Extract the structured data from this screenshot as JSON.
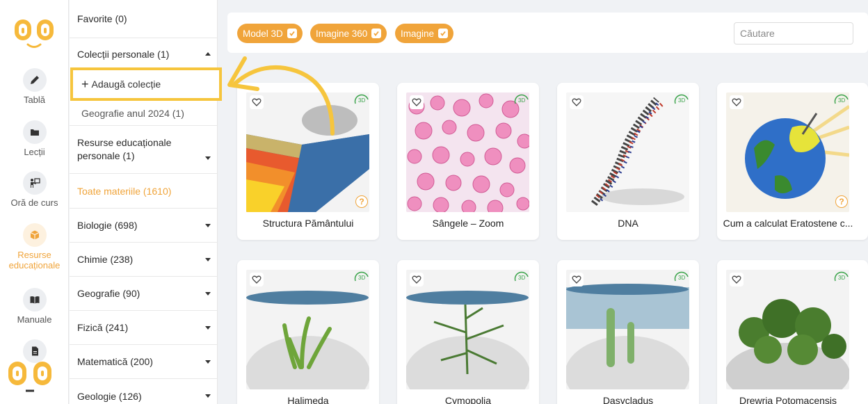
{
  "rail": {
    "items": [
      {
        "label": "Tablă",
        "icon": "pencil-icon"
      },
      {
        "label": "Lecții",
        "icon": "folder-icon"
      },
      {
        "label": "Oră de curs",
        "icon": "teacher-icon"
      },
      {
        "label": "Resurse educaționale",
        "icon": "cube-icon",
        "active": true
      },
      {
        "label": "Manuale",
        "icon": "book-icon"
      },
      {
        "label": "",
        "icon": "document-icon"
      }
    ]
  },
  "sidebar": {
    "favorites": "Favorite (0)",
    "personal_collections": "Colecții personale (1)",
    "add_collection": "Adaugă colecție",
    "collection_item": "Geografie anul 2024 (1)",
    "personal_resources": "Resurse educaționale personale (1)",
    "all_materials": "Toate materiile (1610)",
    "subjects": [
      "Biologie (698)",
      "Chimie (238)",
      "Geografie (90)",
      "Fizică (241)",
      "Matematică (200)",
      "Geologie (126)"
    ]
  },
  "filters": {
    "chips": [
      "Model 3D",
      "Imagine 360",
      "Imagine"
    ],
    "search_placeholder": "Căutare"
  },
  "cards": [
    {
      "title": "Structura Pământului",
      "help": "?"
    },
    {
      "title": "Sângele – Zoom"
    },
    {
      "title": "DNA"
    },
    {
      "title": "Cum a calculat Eratostene c...",
      "help": "?"
    },
    {
      "title": "Halimeda"
    },
    {
      "title": "Cymopolia"
    },
    {
      "title": "Dasycladus"
    },
    {
      "title": "Drewria Potomacensis"
    }
  ],
  "badge_label": "3D",
  "colors": {
    "accent": "#f0a43a",
    "highlight": "#f6c53d",
    "badge_green": "#3aa34a"
  }
}
